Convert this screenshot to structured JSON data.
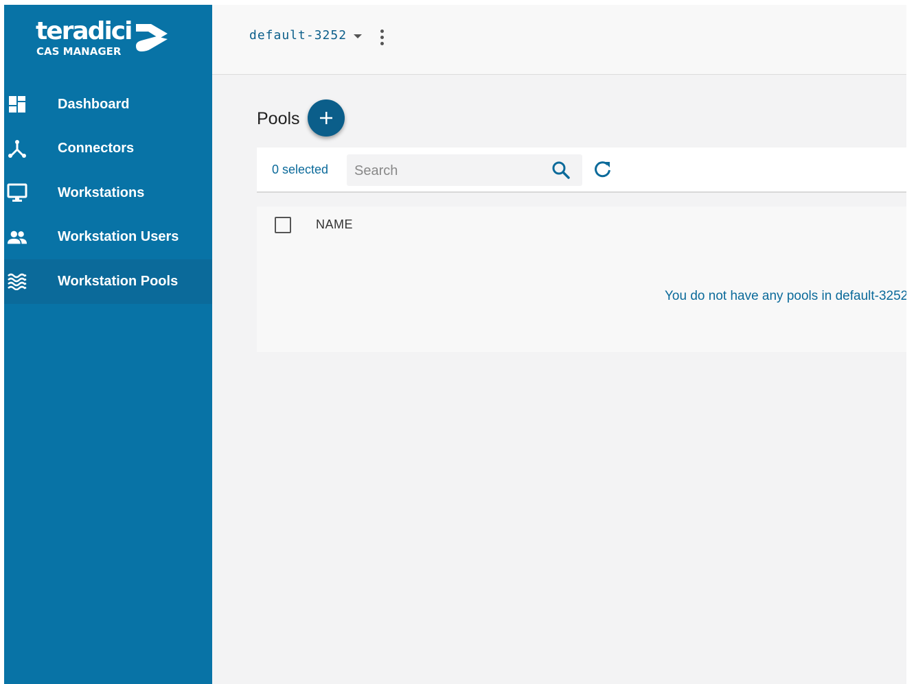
{
  "brand": {
    "name": "teradici",
    "product": "CAS MANAGER"
  },
  "sidebar": {
    "items": [
      {
        "label": "Dashboard",
        "icon": "dashboard-icon"
      },
      {
        "label": "Connectors",
        "icon": "connectors-icon"
      },
      {
        "label": "Workstations",
        "icon": "monitor-icon"
      },
      {
        "label": "Workstation Users",
        "icon": "users-icon"
      },
      {
        "label": "Workstation Pools",
        "icon": "pools-icon",
        "active": true
      }
    ]
  },
  "topbar": {
    "deployment": "default-3252"
  },
  "page": {
    "title": "Pools"
  },
  "toolbar": {
    "selected": "0 selected",
    "search_placeholder": "Search"
  },
  "table": {
    "columns": [
      "NAME"
    ],
    "empty_message": "You do not have any pools in default-3252"
  },
  "colors": {
    "sidebar": "#0873a6",
    "accent": "#0b5e8a",
    "background": "#f3f3f4"
  }
}
